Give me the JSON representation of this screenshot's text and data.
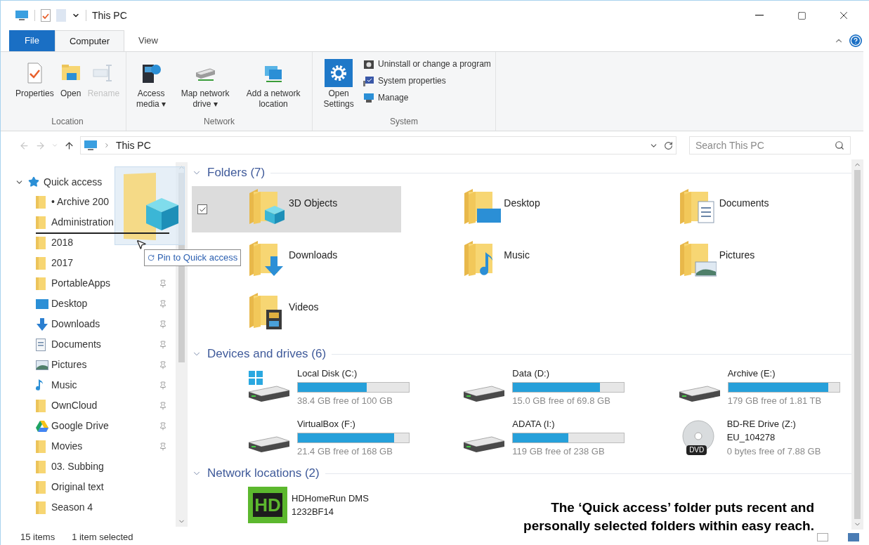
{
  "window": {
    "title": "This PC"
  },
  "ribbon_tabs": [
    {
      "label": "File",
      "kind": "file",
      "selected": false
    },
    {
      "label": "Computer",
      "kind": "tab",
      "selected": true
    },
    {
      "label": "View",
      "kind": "tab",
      "selected": false
    }
  ],
  "ribbon_groups": [
    {
      "label": "Location",
      "items": [
        {
          "label": "Properties",
          "kind": "properties",
          "disabled": false
        },
        {
          "label": "Open",
          "kind": "open",
          "disabled": false
        },
        {
          "label": "Rename",
          "kind": "rename",
          "disabled": true
        }
      ]
    },
    {
      "label": "Network",
      "items": [
        {
          "label": "Access media ▾",
          "kind": "media",
          "disabled": false
        },
        {
          "label": "Map network drive ▾",
          "kind": "netdrive",
          "disabled": false
        },
        {
          "label": "Add a network location",
          "kind": "netloc",
          "disabled": false
        }
      ]
    },
    {
      "label": "System",
      "items": [
        {
          "label": "Open Settings",
          "kind": "settings",
          "disabled": false
        }
      ],
      "small_items": [
        {
          "label": "Uninstall or change a program",
          "kind": "uninstall"
        },
        {
          "label": "System properties",
          "kind": "sysprops"
        },
        {
          "label": "Manage",
          "kind": "manage"
        }
      ]
    }
  ],
  "address_bar": {
    "path": "This PC",
    "search_placeholder": "Search This PC"
  },
  "sidebar": {
    "header": "Quick access",
    "expanded": true,
    "items": [
      {
        "label": "• Archive 200",
        "kind": "folder",
        "pinned": false
      },
      {
        "label": "Administration",
        "kind": "folder",
        "pinned": false
      },
      {
        "label": "2018",
        "kind": "folder",
        "pinned": false
      },
      {
        "label": "2017",
        "kind": "folder",
        "pinned": false
      },
      {
        "label": "PortableApps",
        "kind": "folder",
        "pinned": true
      },
      {
        "label": "Desktop",
        "kind": "desktop",
        "pinned": true
      },
      {
        "label": "Downloads",
        "kind": "downloads",
        "pinned": true
      },
      {
        "label": "Documents",
        "kind": "documents",
        "pinned": true
      },
      {
        "label": "Pictures",
        "kind": "pictures",
        "pinned": true
      },
      {
        "label": "Music",
        "kind": "music",
        "pinned": true
      },
      {
        "label": "OwnCloud",
        "kind": "folder",
        "pinned": true
      },
      {
        "label": "Google Drive",
        "kind": "gdrive",
        "pinned": true
      },
      {
        "label": "Movies",
        "kind": "folder",
        "pinned": true
      },
      {
        "label": "03. Subbing",
        "kind": "folder",
        "pinned": false
      },
      {
        "label": "Original text",
        "kind": "folder",
        "pinned": false
      },
      {
        "label": "Season 4",
        "kind": "folder",
        "pinned": false
      }
    ]
  },
  "drag_tooltip": "Pin to Quick access",
  "folders": {
    "header": "Folders (7)",
    "expanded": true,
    "items": [
      {
        "label": "3D Objects",
        "kind": "objects",
        "selected": true
      },
      {
        "label": "Desktop",
        "kind": "desktop",
        "selected": false
      },
      {
        "label": "Documents",
        "kind": "documents",
        "selected": false
      },
      {
        "label": "Downloads",
        "kind": "downloads",
        "selected": false
      },
      {
        "label": "Music",
        "kind": "music",
        "selected": false
      },
      {
        "label": "Pictures",
        "kind": "pictures",
        "selected": false
      },
      {
        "label": "Videos",
        "kind": "videos",
        "selected": false
      }
    ]
  },
  "drives": {
    "header": "Devices and drives (6)",
    "expanded": true,
    "items": [
      {
        "label": "Local Disk (C:)",
        "kind": "system",
        "level": 0.62,
        "free": "38.4 GB free of 100 GB"
      },
      {
        "label": "Data (D:)",
        "kind": "disk",
        "level": 0.78,
        "free": "15.0 GB free of 69.8 GB"
      },
      {
        "label": "Archive (E:)",
        "kind": "disk",
        "level": 0.9,
        "free": "179 GB free of 1.81 TB"
      },
      {
        "label": "VirtualBox (F:)",
        "kind": "disk",
        "level": 0.87,
        "free": "21.4 GB free of 168 GB"
      },
      {
        "label": "ADATA (I:)",
        "kind": "disk",
        "level": 0.5,
        "free": "119 GB free of 238 GB"
      },
      {
        "label": "BD-RE Drive (Z:)",
        "kind": "optical",
        "volume": "EU_104278",
        "badge": "DVD",
        "free": "0 bytes free of 7.88 GB"
      }
    ]
  },
  "network": {
    "header": "Network locations (2)",
    "expanded": true,
    "items": [
      {
        "label": "HDHomeRun DMS",
        "badge": "HD",
        "subtitle": "1232BF14"
      }
    ]
  },
  "status_bar": {
    "count": "15 items",
    "selection": "1 item selected"
  },
  "caption": [
    "The ‘Quick access’ folder puts recent and",
    "personally selected folders within easy reach."
  ]
}
